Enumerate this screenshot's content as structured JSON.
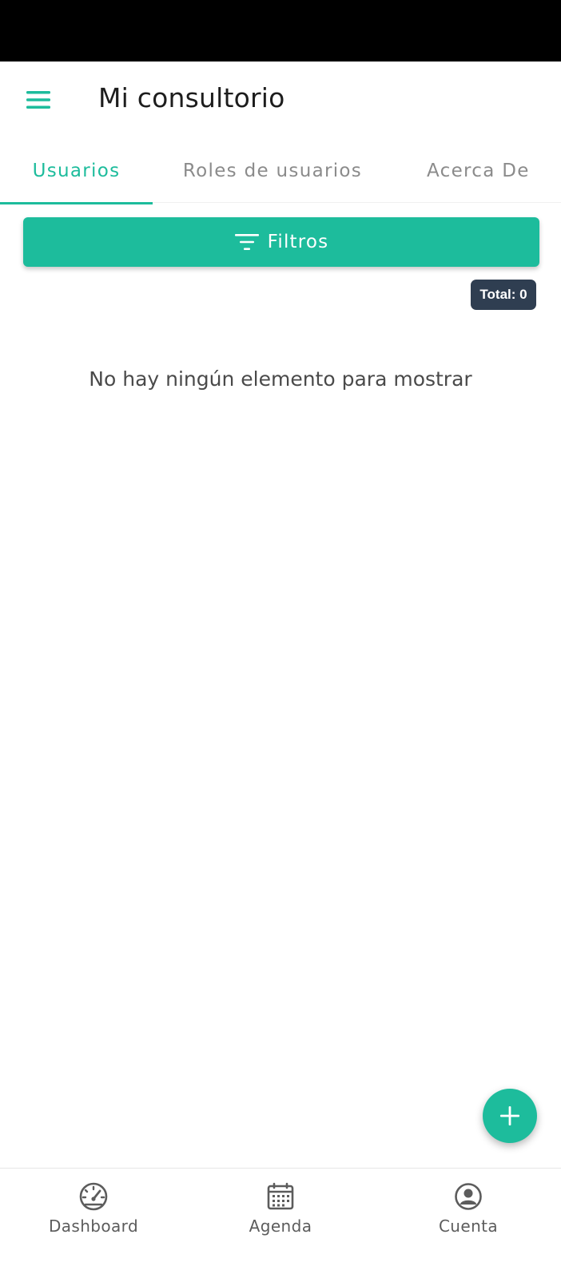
{
  "app": {
    "title": "Mi consultorio",
    "accent_color": "#1dbc9c",
    "badge_color": "#2f3e51"
  },
  "header": {
    "menu_icon": "hamburger-menu-icon"
  },
  "tabs": [
    {
      "label": "Usuarios",
      "active": true
    },
    {
      "label": "Roles de usuarios",
      "active": false
    },
    {
      "label": "Acerca De",
      "active": false
    }
  ],
  "filters": {
    "label": "Filtros",
    "icon": "filter-list-icon"
  },
  "total_badge": "Total: 0",
  "empty_state": "No hay ningún elemento para mostrar",
  "fab": {
    "icon": "plus-icon"
  },
  "bottom_nav": [
    {
      "label": "Dashboard",
      "icon": "speedometer-icon"
    },
    {
      "label": "Agenda",
      "icon": "calendar-icon"
    },
    {
      "label": "Cuenta",
      "icon": "account-circle-icon"
    }
  ]
}
